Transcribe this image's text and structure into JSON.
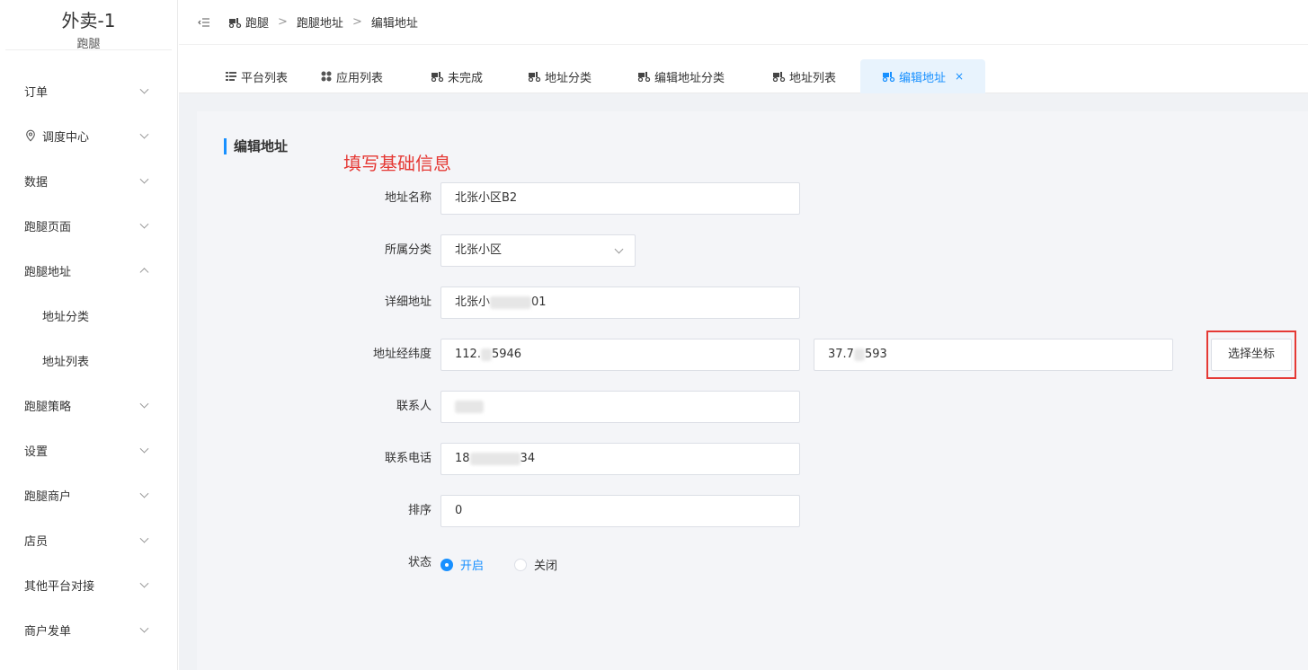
{
  "brand": {
    "title": "外卖-1",
    "subtitle": "跑腿"
  },
  "sidebar": {
    "items": [
      {
        "label": "订单"
      },
      {
        "label": "调度中心"
      },
      {
        "label": "数据"
      },
      {
        "label": "跑腿页面"
      },
      {
        "label": "跑腿地址"
      },
      {
        "label": "地址分类"
      },
      {
        "label": "地址列表"
      },
      {
        "label": "跑腿策略"
      },
      {
        "label": "设置"
      },
      {
        "label": "跑腿商户"
      },
      {
        "label": "店员"
      },
      {
        "label": "其他平台对接"
      },
      {
        "label": "商户发单"
      }
    ]
  },
  "breadcrumb": {
    "items": [
      "跑腿",
      "跑腿地址",
      "编辑地址"
    ],
    "separator": ">"
  },
  "tabs": [
    {
      "label": "平台列表"
    },
    {
      "label": "应用列表"
    },
    {
      "label": "未完成"
    },
    {
      "label": "地址分类"
    },
    {
      "label": "编辑地址分类"
    },
    {
      "label": "地址列表"
    },
    {
      "label": "编辑地址",
      "close": "×"
    }
  ],
  "page": {
    "section_title": "编辑地址",
    "note": "填写基础信息"
  },
  "form": {
    "name": {
      "label": "地址名称",
      "value": "北张小区B2"
    },
    "category": {
      "label": "所属分类",
      "value": "北张小区"
    },
    "detail": {
      "label": "详细地址",
      "value_prefix": "北张小",
      "value_suffix": "01"
    },
    "coords": {
      "label": "地址经纬度",
      "lng_prefix": "112.",
      "lng_suffix": "5946",
      "lat_prefix": "37.7",
      "lat_suffix": "593",
      "button": "选择坐标"
    },
    "contact": {
      "label": "联系人"
    },
    "phone": {
      "label": "联系电话",
      "value_prefix": "18",
      "value_suffix": "34"
    },
    "sort": {
      "label": "排序",
      "value": "0"
    },
    "status": {
      "label": "状态",
      "options": [
        "开启",
        "关闭"
      ],
      "selected": "开启"
    }
  },
  "colors": {
    "accent": "#1890ff",
    "highlight": "#e53935",
    "note": "#e53935"
  }
}
